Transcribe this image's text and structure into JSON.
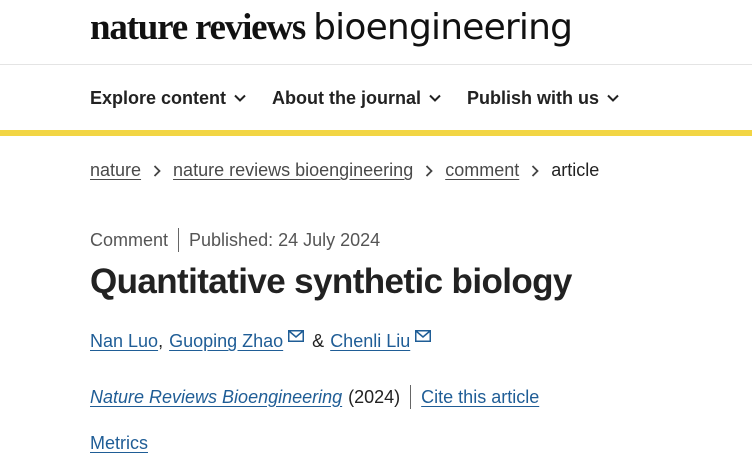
{
  "brand": {
    "bold": "nature reviews",
    "light": "bioengineering"
  },
  "nav": [
    {
      "label": "Explore content",
      "icon": "chevron-down-icon"
    },
    {
      "label": "About the journal",
      "icon": "chevron-down-icon"
    },
    {
      "label": "Publish with us",
      "icon": "chevron-down-icon"
    }
  ],
  "colors": {
    "accent": "#f2d544",
    "link": "#1f5d96",
    "text": "#222222"
  },
  "breadcrumb": {
    "items": [
      "nature",
      "nature reviews bioengineering",
      "comment"
    ],
    "current": "article"
  },
  "article": {
    "type": "Comment",
    "published": "Published: 24 July 2024",
    "title": "Quantitative synthetic biology",
    "authors": {
      "a1": "Nan Luo",
      "sep1": ",",
      "a2": "Guoping Zhao",
      "amp": "&",
      "a3": "Chenli Liu"
    },
    "journal": "Nature Reviews Bioengineering",
    "year": "(2024)",
    "cite": "Cite this article",
    "metrics": "Metrics"
  }
}
